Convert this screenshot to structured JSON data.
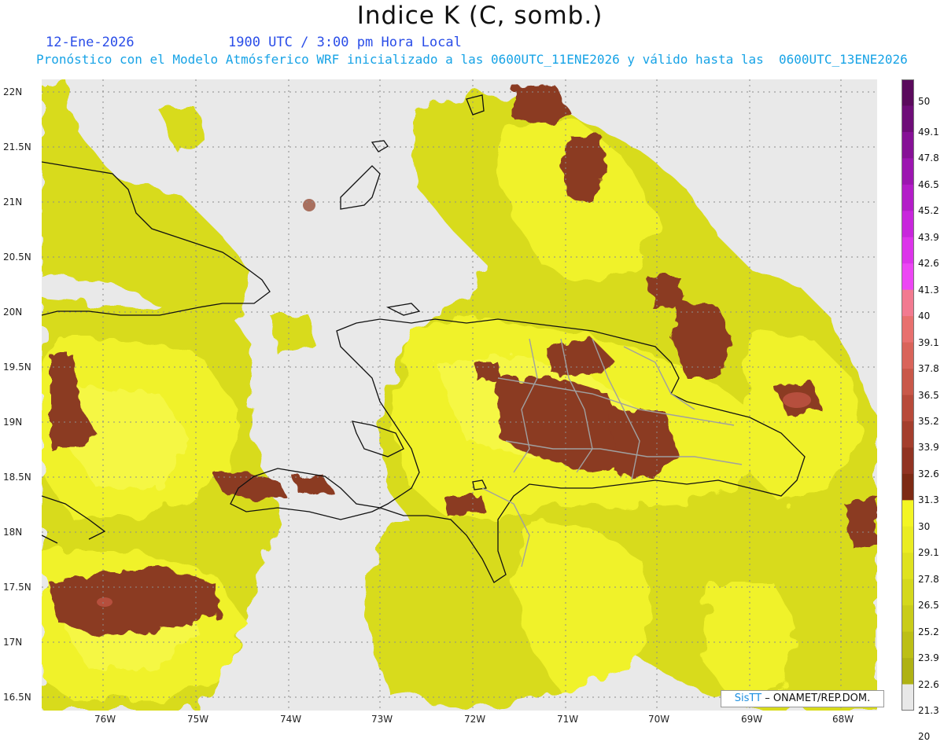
{
  "header": {
    "title": "Indice K (C, somb.)",
    "date": "12-Ene-2026",
    "time": "1900 UTC / 3:00 pm Hora Local",
    "model_info": "Pronóstico con el Modelo Atmósferico WRF inicializado a las 0600UTC_11ENE2026 y válido hasta las  0600UTC_13ENE2026"
  },
  "axes": {
    "lat_labels": [
      "22N",
      "21.5N",
      "21N",
      "20.5N",
      "20N",
      "19.5N",
      "19N",
      "18.5N",
      "18N",
      "17.5N",
      "17N",
      "16.5N"
    ],
    "lon_labels": [
      "76W",
      "75W",
      "74W",
      "73W",
      "72W",
      "71W",
      "70W",
      "69W",
      "68W"
    ]
  },
  "colorbar": {
    "levels": [
      "50",
      "49.1",
      "47.8",
      "46.5",
      "45.2",
      "43.9",
      "42.6",
      "41.3",
      "40",
      "39.1",
      "37.8",
      "36.5",
      "35.2",
      "33.9",
      "32.6",
      "31.3",
      "30",
      "29.1",
      "27.8",
      "26.5",
      "25.2",
      "23.9",
      "22.6",
      "21.3",
      "20"
    ],
    "colors": [
      "#5a0a5c",
      "#6e0d78",
      "#861196",
      "#9c16b0",
      "#b31dc8",
      "#c826dc",
      "#dc34ea",
      "#ec46f4",
      "#f27a90",
      "#e8706e",
      "#d9645a",
      "#c95849",
      "#b84a3a",
      "#a43e2d",
      "#913322",
      "#7d2a14",
      "#f3f524",
      "#eaec22",
      "#dfe21f",
      "#d4d81c",
      "#c9cc19",
      "#bcbf16",
      "#afb214",
      "#e8e8e8"
    ]
  },
  "colors": {
    "background": "#e9e9e9",
    "low": "#d8db1e",
    "mid": "#f0f22b",
    "high": "#8b3a22",
    "coast": "#111111",
    "provinces": "#a0a0a0"
  },
  "credit": {
    "brand": "SisTT",
    "text": " – ONAMET/REP.DOM."
  }
}
